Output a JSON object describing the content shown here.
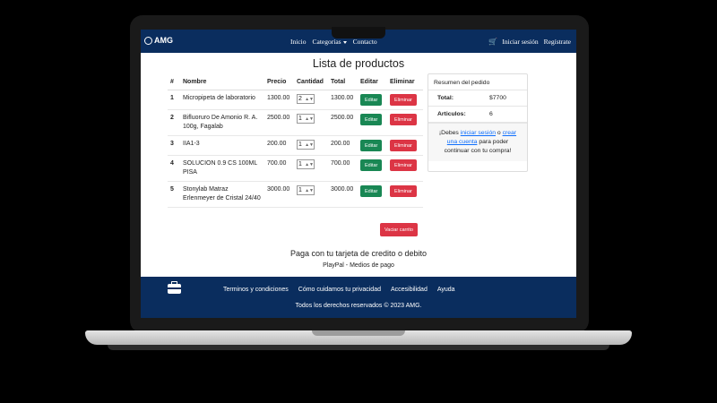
{
  "navbar": {
    "brand": "AMG",
    "links": [
      "Inicio",
      "Categorías",
      "Contacto"
    ],
    "login": "Iniciar sesión",
    "register": "Regístrate"
  },
  "main": {
    "title": "Lista de productos",
    "headers": [
      "#",
      "Nombre",
      "Precio",
      "Cantidad",
      "Total",
      "Editar",
      "Eliminar"
    ],
    "rows": [
      {
        "num": "1",
        "name": "Micropipeta de laboratorio",
        "price": "1300.00",
        "qty": "2",
        "total": "1300.00"
      },
      {
        "num": "2",
        "name": "Bifluoruro De Amonio R. A. 100g, Fagalab",
        "price": "2500.00",
        "qty": "1",
        "total": "2500.00"
      },
      {
        "num": "3",
        "name": "IIA1-3",
        "price": "200.00",
        "qty": "1",
        "total": "200.00"
      },
      {
        "num": "4",
        "name": "SOLUCION 0.9 CS 100ML PISA",
        "price": "700.00",
        "qty": "1",
        "total": "700.00"
      },
      {
        "num": "5",
        "name": "Stonylab Matraz Erlenmeyer de Cristal 24/40",
        "price": "3000.00",
        "qty": "1",
        "total": "3000.00"
      }
    ],
    "edit_label": "Editar",
    "delete_label": "Eliminar",
    "clear_label": "Vaciar carrito"
  },
  "summary": {
    "title": "Resumen del pedido",
    "total_label": "Total:",
    "total_value": "$7700",
    "items_label": "Articulos:",
    "items_value": "6",
    "note_prefix": "¡Debes",
    "login_link": "iniciar sesión",
    "note_or": "o",
    "create_link": "crear una cuenta",
    "note_suffix": "para poder continuar con tu compra!"
  },
  "payment": {
    "title": "Paga con tu tarjeta de credito o debito",
    "methods": "PlayPal - Medios de pago"
  },
  "footer": {
    "links": [
      "Terminos y condiciones",
      "Cómo cuidamos tu privacidad",
      "Accesibilidad",
      "Ayuda"
    ],
    "copyright": "Todos los derechos reservados © 2023 AMG."
  },
  "colors": {
    "navbar": "#0a2d5e",
    "edit": "#198754",
    "delete": "#dc3545",
    "link": "#0d6efd"
  }
}
